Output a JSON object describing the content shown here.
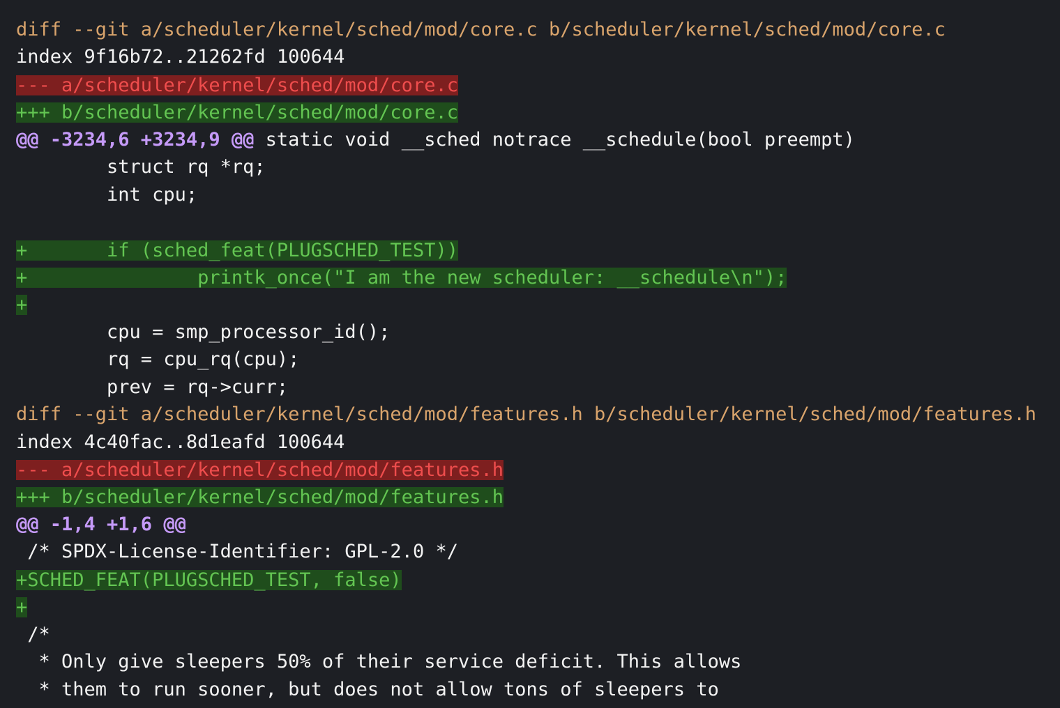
{
  "diff": {
    "lines": [
      {
        "kind": "header",
        "text": "diff --git a/scheduler/kernel/sched/mod/core.c b/scheduler/kernel/sched/mod/core.c"
      },
      {
        "kind": "plain",
        "text": "index 9f16b72..21262fd 100644"
      },
      {
        "kind": "removed",
        "text": "--- a/scheduler/kernel/sched/mod/core.c"
      },
      {
        "kind": "added",
        "text": "+++ b/scheduler/kernel/sched/mod/core.c"
      },
      {
        "kind": "hunk",
        "hunk": "@@ -3234,6 +3234,9 @@",
        "context": " static void __sched notrace __schedule(bool preempt)"
      },
      {
        "kind": "plain",
        "text": "        struct rq *rq;"
      },
      {
        "kind": "plain",
        "text": "        int cpu;"
      },
      {
        "kind": "plain",
        "text": ""
      },
      {
        "kind": "added",
        "text": "+       if (sched_feat(PLUGSCHED_TEST))"
      },
      {
        "kind": "added",
        "text": "+               printk_once(\"I am the new scheduler: __schedule\\n\");"
      },
      {
        "kind": "added",
        "text": "+"
      },
      {
        "kind": "plain",
        "text": "        cpu = smp_processor_id();"
      },
      {
        "kind": "plain",
        "text": "        rq = cpu_rq(cpu);"
      },
      {
        "kind": "plain",
        "text": "        prev = rq->curr;"
      },
      {
        "kind": "header",
        "text": "diff --git a/scheduler/kernel/sched/mod/features.h b/scheduler/kernel/sched/mod/features.h"
      },
      {
        "kind": "plain",
        "text": "index 4c40fac..8d1eafd 100644"
      },
      {
        "kind": "removed",
        "text": "--- a/scheduler/kernel/sched/mod/features.h"
      },
      {
        "kind": "added",
        "text": "+++ b/scheduler/kernel/sched/mod/features.h"
      },
      {
        "kind": "hunk",
        "hunk": "@@ -1,4 +1,6 @@",
        "context": ""
      },
      {
        "kind": "plain",
        "text": " /* SPDX-License-Identifier: GPL-2.0 */"
      },
      {
        "kind": "added",
        "text": "+SCHED_FEAT(PLUGSCHED_TEST, false)"
      },
      {
        "kind": "added",
        "text": "+"
      },
      {
        "kind": "plain",
        "text": " /*"
      },
      {
        "kind": "plain",
        "text": "  * Only give sleepers 50% of their service deficit. This allows"
      },
      {
        "kind": "plain",
        "text": "  * them to run sooner, but does not allow tons of sleepers to"
      }
    ]
  },
  "colors": {
    "background": "#1d1f24",
    "header": "#d9a46c",
    "removed_bg": "#7e1f1f",
    "removed_fg": "#ef4d4d",
    "added_bg": "#1f4d1c",
    "added_fg": "#63c552",
    "hunk": "#c59af8"
  }
}
